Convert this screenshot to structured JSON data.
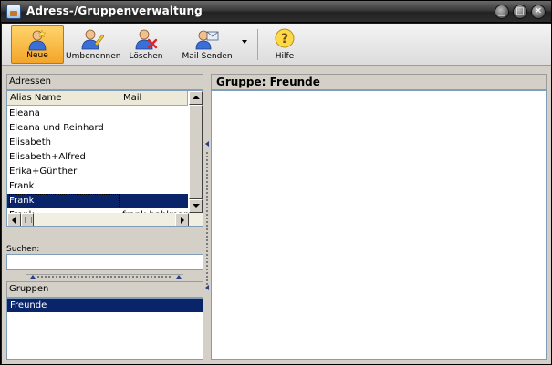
{
  "window": {
    "title": "Adress-/Gruppenverwaltung",
    "controls": {
      "minimize": "▁",
      "maximize": "□",
      "close": "✕"
    }
  },
  "toolbar": {
    "buttons": [
      {
        "label": "Neue",
        "icon": "new-person-icon",
        "active": true
      },
      {
        "label": "Umbenennen",
        "icon": "rename-person-icon",
        "active": false
      },
      {
        "label": "Löschen",
        "icon": "delete-person-icon",
        "active": false
      },
      {
        "label": "Mail Senden",
        "icon": "send-mail-icon",
        "active": false
      },
      {
        "label": "Hilfe",
        "icon": "help-icon",
        "active": false
      }
    ]
  },
  "addresses": {
    "header": "Adressen",
    "columns": [
      "Alias Name",
      "Mail"
    ],
    "rows": [
      {
        "alias": "Eleana",
        "mail": ""
      },
      {
        "alias": "Eleana und Reinhard",
        "mail": ""
      },
      {
        "alias": "Elisabeth",
        "mail": ""
      },
      {
        "alias": "Elisabeth+Alfred",
        "mail": ""
      },
      {
        "alias": "Erika+Günther",
        "mail": ""
      },
      {
        "alias": "Frank",
        "mail": ""
      },
      {
        "alias": "Frank",
        "mail": "",
        "selected": true
      },
      {
        "alias": "Frank",
        "mail": "frank-bahlmann"
      }
    ]
  },
  "search": {
    "label": "Suchen:",
    "value": ""
  },
  "groups": {
    "header": "Gruppen",
    "items": [
      {
        "label": "Freunde",
        "selected": true
      }
    ]
  },
  "detail": {
    "header": "Gruppe: Freunde"
  },
  "colors": {
    "selection": "#0a246a",
    "toolbar_active": "#f3a52a",
    "titlebar": "#2e2e2e",
    "panel": "#d4d0c8"
  }
}
